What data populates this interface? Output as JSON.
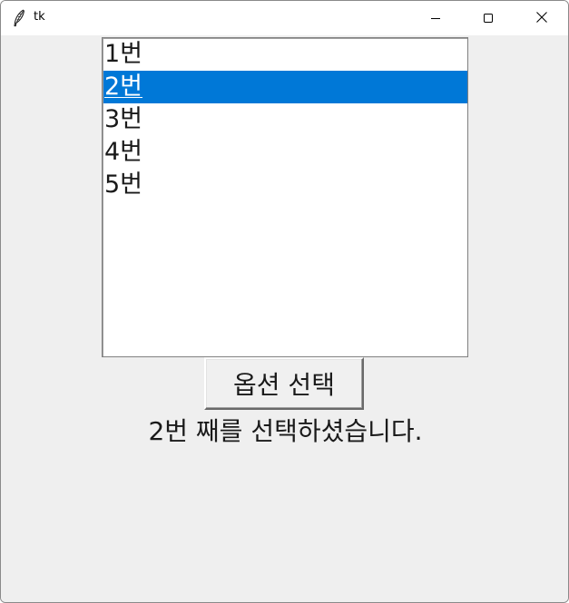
{
  "window": {
    "title": "tk"
  },
  "icons": {
    "app": "feather-icon",
    "minimize": "minimize-icon",
    "maximize": "maximize-icon",
    "close": "close-icon"
  },
  "listbox": {
    "items": [
      {
        "label": "1번"
      },
      {
        "label": "2번"
      },
      {
        "label": "3번"
      },
      {
        "label": "4번"
      },
      {
        "label": "5번"
      }
    ],
    "selected_index": 1
  },
  "button": {
    "label": "옵션 선택"
  },
  "result": {
    "text": "2번 째를 선택하셨습니다."
  },
  "colors": {
    "selection": "#0078d7",
    "background": "#efefef"
  }
}
